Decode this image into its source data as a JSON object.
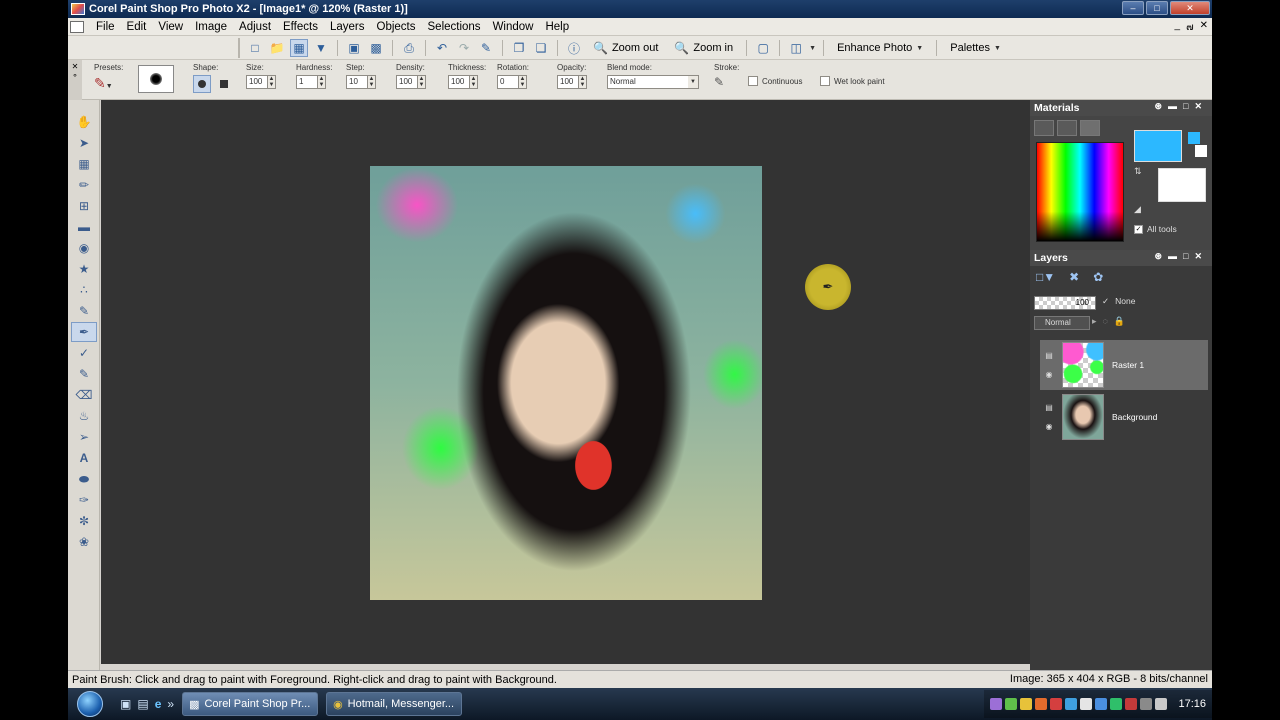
{
  "window": {
    "title": "Corel Paint Shop Pro Photo X2 - [Image1* @ 120% (Raster 1)]",
    "buttons": [
      "–",
      "□",
      "✕"
    ]
  },
  "menu": {
    "items": [
      "File",
      "Edit",
      "View",
      "Image",
      "Adjust",
      "Effects",
      "Layers",
      "Objects",
      "Selections",
      "Window",
      "Help"
    ],
    "mdi_buttons": [
      "_",
      "๗",
      "✕"
    ]
  },
  "toolbar": {
    "zoom_out": "Zoom out",
    "zoom_in": "Zoom in",
    "enhance_photo": "Enhance Photo",
    "palettes": "Palettes"
  },
  "tool_options": {
    "presets_label": "Presets:",
    "shape_label": "Shape:",
    "size_label": "Size:",
    "size_value": "100",
    "hardness_label": "Hardness:",
    "hardness_value": "1",
    "step_label": "Step:",
    "step_value": "10",
    "density_label": "Density:",
    "density_value": "100",
    "thickness_label": "Thickness:",
    "thickness_value": "100",
    "rotation_label": "Rotation:",
    "rotation_value": "0",
    "opacity_label": "Opacity:",
    "opacity_value": "100",
    "blend_label": "Blend mode:",
    "blend_value": "Normal",
    "stroke_label": "Stroke:",
    "continuous_label": "Continuous",
    "wetlook_label": "Wet look paint"
  },
  "materials": {
    "title": "Materials",
    "foreground_color": "#2cb8ff",
    "background_color": "#ffffff",
    "all_tools_label": "All tools"
  },
  "layers": {
    "title": "Layers",
    "opacity_value": "100",
    "none_label": "None",
    "blend_value": "Normal",
    "items": [
      {
        "name": "Raster 1",
        "selected": true
      },
      {
        "name": "Background",
        "selected": false
      }
    ]
  },
  "status": {
    "hint": "Paint Brush: Click and drag to paint with Foreground. Right-click and drag to paint with Background.",
    "image_info": "Image:  365 x 404 x RGB - 8 bits/channel"
  },
  "taskbar": {
    "tasks": [
      {
        "label": "Corel Paint Shop Pr...",
        "active": true
      },
      {
        "label": "Hotmail, Messenger...",
        "active": false
      }
    ],
    "clock": "17:16"
  }
}
